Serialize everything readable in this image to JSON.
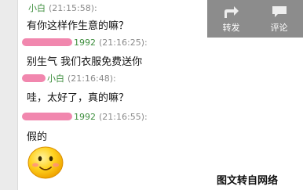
{
  "share_panel": {
    "forward_label": "转发",
    "comment_label": "评论"
  },
  "messages": [
    {
      "name": "小白",
      "time": "(21:15:58):",
      "text": "有你这样作生意的嘛？"
    },
    {
      "name": "1992",
      "time": "(21:16:25):",
      "text": "别生气 我们衣服免费送你"
    },
    {
      "name": "小白",
      "time": "(21:16:48):",
      "text": "哇，太好了，真的嘛？"
    },
    {
      "name": "1992",
      "time": "(21:16:55):",
      "text": "假的"
    }
  ],
  "watermark": "图文转自网络",
  "colors": {
    "name_green": "#3f8f3f",
    "redaction_pink": "#f07aa5",
    "share_panel_bg": "#8c8c8c"
  }
}
